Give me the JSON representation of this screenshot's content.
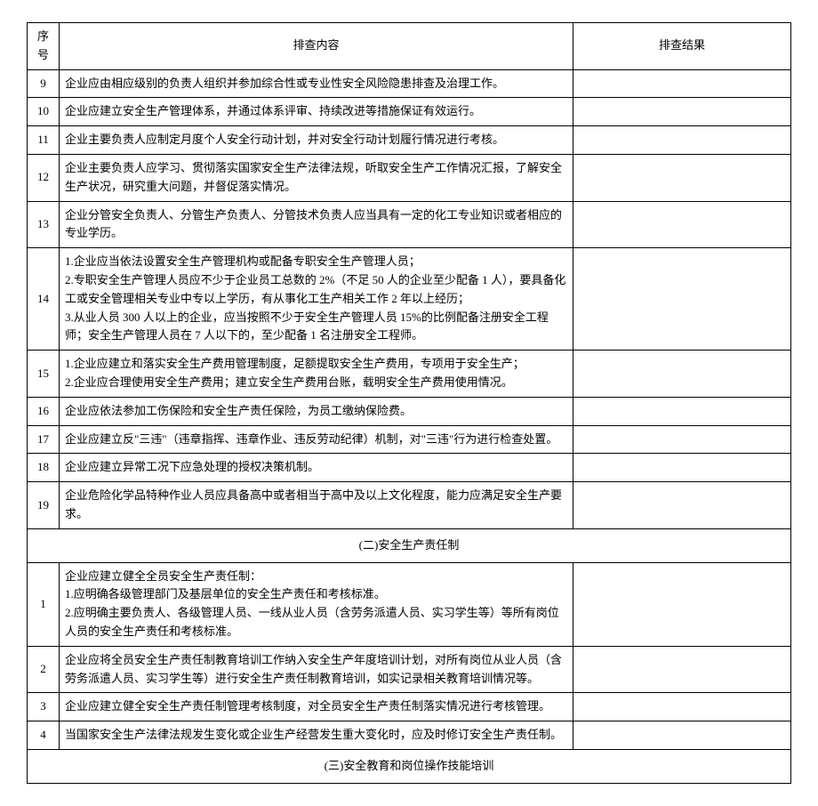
{
  "headers": {
    "num": "序号",
    "content": "排查内容",
    "result": "排查结果"
  },
  "section1_rows": [
    {
      "n": "9",
      "c": "企业应由相应级别的负责人组织并参加综合性或专业性安全风险隐患排查及治理工作。"
    },
    {
      "n": "10",
      "c": "企业应建立安全生产管理体系，并通过体系评审、持续改进等措施保证有效运行。"
    },
    {
      "n": "11",
      "c": "企业主要负责人应制定月度个人安全行动计划，并对安全行动计划履行情况进行考核。"
    },
    {
      "n": "12",
      "c": "企业主要负责人应学习、贯彻落实国家安全生产法律法规，听取安全生产工作情况汇报，了解安全生产状况，研究重大问题，并督促落实情况。"
    },
    {
      "n": "13",
      "c": "企业分管安全负责人、分管生产负责人、分管技术负责人应当具有一定的化工专业知识或者相应的专业学历。"
    },
    {
      "n": "14",
      "c": "1.企业应当依法设置安全生产管理机构或配备专职安全生产管理人员；\n2.专职安全生产管理人员应不少于企业员工总数的 2%（不足 50 人的企业至少配备 1 人），要具备化工或安全管理相关专业中专以上学历，有从事化工生产相关工作 2 年以上经历；\n3.从业人员 300 人以上的企业，应当按照不少于安全生产管理人员 15%的比例配备注册安全工程师；安全生产管理人员在 7 人以下的，至少配备 1 名注册安全工程师。"
    },
    {
      "n": "15",
      "c": "1.企业应建立和落实安全生产费用管理制度，足额提取安全生产费用，专项用于安全生产；\n2.企业应合理使用安全生产费用；建立安全生产费用台账，载明安全生产费用使用情况。"
    },
    {
      "n": "16",
      "c": "企业应依法参加工伤保险和安全生产责任保险，为员工缴纳保险费。"
    },
    {
      "n": "17",
      "c": "企业应建立反\"三违\"（违章指挥、违章作业、违反劳动纪律）机制，对\"三违\"行为进行检查处置。"
    },
    {
      "n": "18",
      "c": "企业应建立异常工况下应急处理的授权决策机制。"
    },
    {
      "n": "19",
      "c": "企业危险化学品特种作业人员应具备高中或者相当于高中及以上文化程度，能力应满足安全生产要求。"
    }
  ],
  "section2_title": "(二)安全生产责任制",
  "section2_rows": [
    {
      "n": "1",
      "c": "企业应建立健全全员安全生产责任制：\n1.应明确各级管理部门及基层单位的安全生产责任和考核标准。\n2.应明确主要负责人、各级管理人员、一线从业人员（含劳务派遣人员、实习学生等）等所有岗位人员的安全生产责任和考核标准。"
    },
    {
      "n": "2",
      "c": "企业应将全员安全生产责任制教育培训工作纳入安全生产年度培训计划，对所有岗位从业人员（含劳务派遣人员、实习学生等）进行安全生产责任制教育培训，如实记录相关教育培训情况等。"
    },
    {
      "n": "3",
      "c": "企业应建立健全安全生产责任制管理考核制度，对全员安全生产责任制落实情况进行考核管理。"
    },
    {
      "n": "4",
      "c": "当国家安全生产法律法规发生变化或企业生产经营发生重大变化时，应及时修订安全生产责任制。"
    }
  ],
  "section3_title": "(三)安全教育和岗位操作技能培训"
}
